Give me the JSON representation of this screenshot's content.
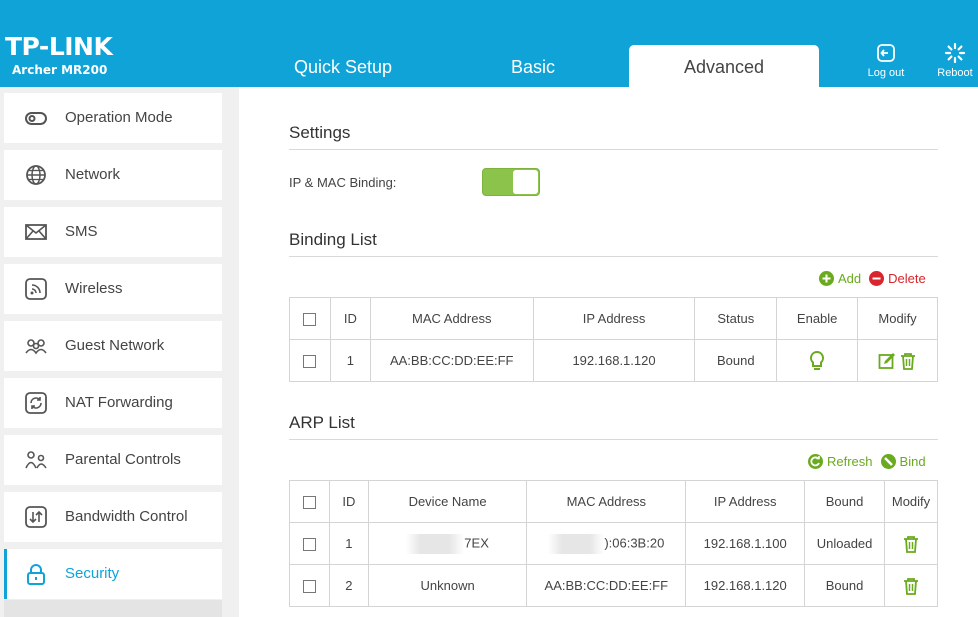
{
  "header": {
    "logo": "TP-LINK",
    "model": "Archer MR200",
    "tabs": [
      {
        "label": "Quick Setup"
      },
      {
        "label": "Basic"
      },
      {
        "label": "Advanced"
      }
    ],
    "logout_label": "Log out",
    "reboot_label": "Reboot",
    "accent_color": "#0fa3d8"
  },
  "sidebar": {
    "items": [
      {
        "label": "Operation Mode",
        "icon": "operation-mode-icon"
      },
      {
        "label": "Network",
        "icon": "globe-icon"
      },
      {
        "label": "SMS",
        "icon": "envelope-icon"
      },
      {
        "label": "Wireless",
        "icon": "wireless-icon"
      },
      {
        "label": "Guest Network",
        "icon": "guest-network-icon"
      },
      {
        "label": "NAT Forwarding",
        "icon": "nat-forwarding-icon"
      },
      {
        "label": "Parental Controls",
        "icon": "parental-controls-icon"
      },
      {
        "label": "Bandwidth Control",
        "icon": "bandwidth-control-icon"
      },
      {
        "label": "Security",
        "icon": "lock-icon",
        "active": true
      }
    ]
  },
  "settings": {
    "title": "Settings",
    "ip_mac_label": "IP & MAC Binding:",
    "ip_mac_enabled": true
  },
  "binding_list": {
    "title": "Binding List",
    "add_label": "Add",
    "delete_label": "Delete",
    "columns": [
      "ID",
      "MAC Address",
      "IP Address",
      "Status",
      "Enable",
      "Modify"
    ],
    "rows": [
      {
        "id": "1",
        "mac": "AA:BB:CC:DD:EE:FF",
        "ip": "192.168.1.120",
        "status": "Bound"
      }
    ]
  },
  "arp_list": {
    "title": "ARP List",
    "refresh_label": "Refresh",
    "bind_label": "Bind",
    "columns": [
      "ID",
      "Device Name",
      "MAC Address",
      "IP Address",
      "Bound",
      "Modify"
    ],
    "rows": [
      {
        "id": "1",
        "device": "7EX",
        "mac": "):06:3B:20",
        "ip": "192.168.1.100",
        "bound": "Unloaded"
      },
      {
        "id": "2",
        "device": "Unknown",
        "mac": "AA:BB:CC:DD:EE:FF",
        "ip": "192.168.1.120",
        "bound": "Bound"
      }
    ]
  }
}
